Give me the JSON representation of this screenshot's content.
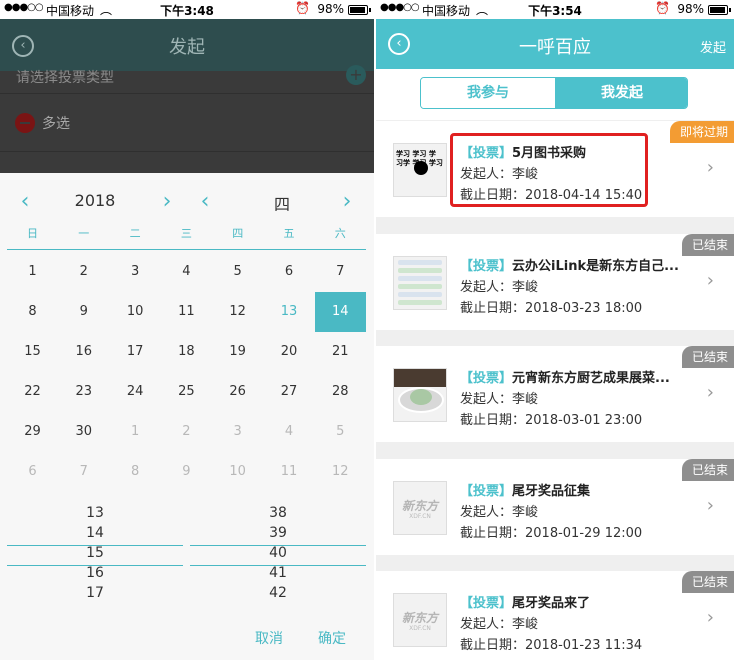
{
  "left": {
    "status": {
      "dots": "●●●○○",
      "carrier": "中国移动",
      "time": "下午3:48",
      "battery": "98%",
      "wifi_icon": "wifi-icon",
      "alarm_icon": "alarm-icon"
    },
    "header": {
      "title": "发起",
      "back_icon": "back-circle-icon"
    },
    "background_rows": {
      "type_placeholder": "请选择投票类型",
      "multi_label": "多选"
    },
    "picker": {
      "year": "2018",
      "week_label": "四",
      "weekdays": [
        "日",
        "一",
        "二",
        "三",
        "四",
        "五",
        "六"
      ],
      "days": [
        [
          {
            "d": "1",
            "s": ""
          },
          {
            "d": "2",
            "s": ""
          },
          {
            "d": "3",
            "s": ""
          },
          {
            "d": "4",
            "s": ""
          },
          {
            "d": "5",
            "s": ""
          },
          {
            "d": "6",
            "s": ""
          },
          {
            "d": "7",
            "s": ""
          }
        ],
        [
          {
            "d": "8",
            "s": ""
          },
          {
            "d": "9",
            "s": ""
          },
          {
            "d": "10",
            "s": ""
          },
          {
            "d": "11",
            "s": ""
          },
          {
            "d": "12",
            "s": ""
          },
          {
            "d": "13",
            "s": "today"
          },
          {
            "d": "14",
            "s": "selected"
          }
        ],
        [
          {
            "d": "15",
            "s": ""
          },
          {
            "d": "16",
            "s": ""
          },
          {
            "d": "17",
            "s": ""
          },
          {
            "d": "18",
            "s": ""
          },
          {
            "d": "19",
            "s": ""
          },
          {
            "d": "20",
            "s": ""
          },
          {
            "d": "21",
            "s": ""
          }
        ],
        [
          {
            "d": "22",
            "s": ""
          },
          {
            "d": "23",
            "s": ""
          },
          {
            "d": "24",
            "s": ""
          },
          {
            "d": "25",
            "s": ""
          },
          {
            "d": "26",
            "s": ""
          },
          {
            "d": "27",
            "s": ""
          },
          {
            "d": "28",
            "s": ""
          }
        ],
        [
          {
            "d": "29",
            "s": ""
          },
          {
            "d": "30",
            "s": ""
          },
          {
            "d": "1",
            "s": "muted"
          },
          {
            "d": "2",
            "s": "muted"
          },
          {
            "d": "3",
            "s": "muted"
          },
          {
            "d": "4",
            "s": "muted"
          },
          {
            "d": "5",
            "s": "muted"
          }
        ],
        [
          {
            "d": "6",
            "s": "muted"
          },
          {
            "d": "7",
            "s": "muted"
          },
          {
            "d": "8",
            "s": "muted"
          },
          {
            "d": "9",
            "s": "muted"
          },
          {
            "d": "10",
            "s": "muted"
          },
          {
            "d": "11",
            "s": "muted"
          },
          {
            "d": "12",
            "s": "muted"
          }
        ]
      ],
      "hours": [
        "13",
        "14",
        "15",
        "16",
        "17"
      ],
      "minutes": [
        "38",
        "39",
        "40",
        "41",
        "42"
      ],
      "cancel_label": "取消",
      "confirm_label": "确定"
    }
  },
  "right": {
    "status": {
      "dots": "●●●○○",
      "carrier": "中国移动",
      "time": "下午3:54",
      "battery": "98%",
      "wifi_icon": "wifi-icon",
      "alarm_icon": "alarm-icon"
    },
    "header": {
      "title": "一呼百应",
      "action": "发起",
      "back_icon": "back-circle-icon"
    },
    "tabs": {
      "joined": "我参与",
      "started": "我发起"
    },
    "owner_label": "发起人：",
    "deadline_label": "截止日期：",
    "tag_label": "【投票】",
    "items": [
      {
        "title": "5月图书采购",
        "owner": "李峻",
        "deadline": "2018-04-14 15:40",
        "badge": "即将过期",
        "status": "warn",
        "thumb": "doodle"
      },
      {
        "title": "云办公iLink是新东方自己...",
        "owner": "李峻",
        "deadline": "2018-03-23 18:00",
        "badge": "已结束",
        "status": "done",
        "thumb": "app"
      },
      {
        "title": "元宵新东方厨艺成果展菜...",
        "owner": "李峻",
        "deadline": "2018-03-01 23:00",
        "badge": "已结束",
        "status": "done",
        "thumb": "food"
      },
      {
        "title": "尾牙奖品征集",
        "owner": "李峻",
        "deadline": "2018-01-29 12:00",
        "badge": "已结束",
        "status": "done",
        "thumb": "logo"
      },
      {
        "title": "尾牙奖品来了",
        "owner": "李峻",
        "deadline": "2018-01-23 11:34",
        "badge": "已结束",
        "status": "done",
        "thumb": "logo"
      }
    ],
    "thumb_doodle_text": "学习 学习 学 习学 学习 学习",
    "thumb_logo_text": "新东方",
    "thumb_logo_sub": "XDF.CN",
    "colors": {
      "accent": "#4cc1cc",
      "warn": "#f39c33",
      "done": "#8e8e8e",
      "highlight": "#e02020"
    }
  }
}
